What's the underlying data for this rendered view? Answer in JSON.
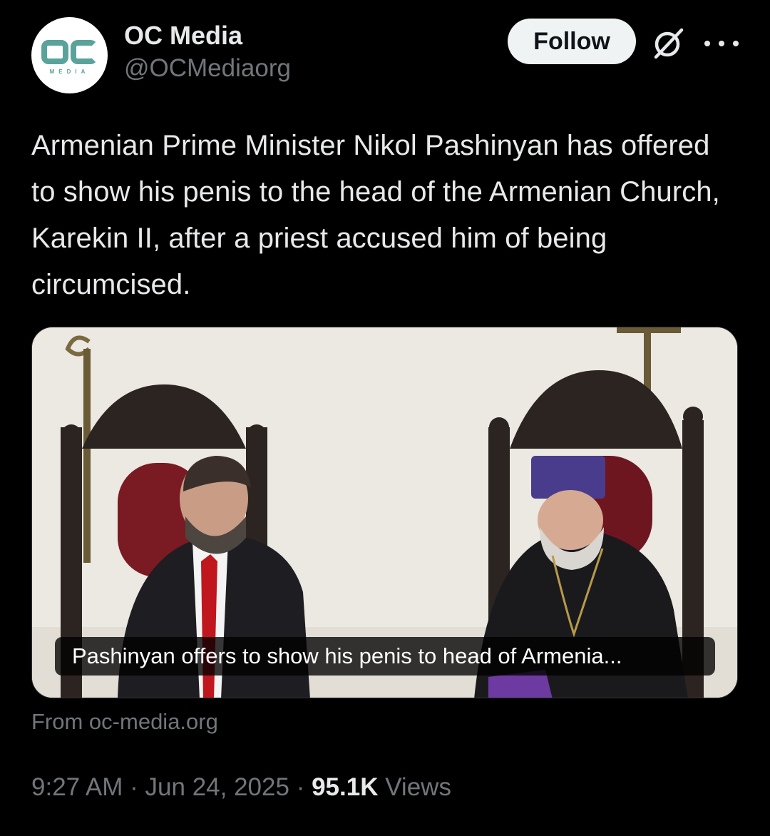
{
  "author": {
    "display_name": "OC Media",
    "handle": "@OCMediaorg",
    "avatar_logo": "OC",
    "avatar_sub": "MEDIA"
  },
  "actions": {
    "follow_label": "Follow",
    "grok_icon": "grok-slash-icon",
    "more_icon": "more-dots-icon"
  },
  "tweet": {
    "text": "Armenian Prime Minister Nikol Pashinyan has offered to show his penis to the head of the Armenian Church, Karekin II, after a priest accused him of being circumcised."
  },
  "card": {
    "caption": "Pashinyan offers to show his penis to head of Armenia...",
    "source": "From oc-media.org"
  },
  "meta": {
    "time": "9:27 AM",
    "separator": "·",
    "date": "Jun 24, 2025",
    "views_count": "95.1K",
    "views_label": "Views"
  },
  "colors": {
    "background": "#000000",
    "text_primary": "#e7e9ea",
    "text_secondary": "#71767b",
    "follow_bg": "#eff3f4",
    "brand_teal": "#5aa39b"
  }
}
